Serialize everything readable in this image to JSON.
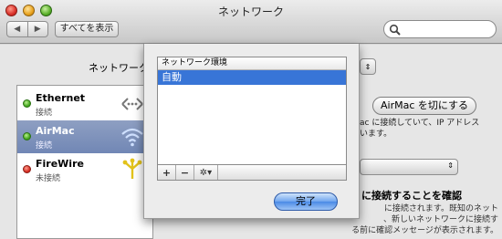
{
  "window": {
    "title": "ネットワーク",
    "back_glyph": "◀",
    "forward_glyph": "▶",
    "show_all_label": "すべてを表示",
    "search_icon": "search-icon"
  },
  "location": {
    "label": "ネットワーク",
    "popup_glyph": "⇕"
  },
  "services": [
    {
      "name": "Ethernet",
      "status": "接続",
      "status_color": "#3ea21a",
      "icon": "ethernet-icon",
      "selected": false
    },
    {
      "name": "AirMac",
      "status": "接続",
      "status_color": "#3ea21a",
      "icon": "wifi-icon",
      "selected": true
    },
    {
      "name": "FireWire",
      "status": "未接続",
      "status_color": "#d2281d",
      "icon": "firewire-icon",
      "selected": false
    }
  ],
  "details": {
    "airmac_button_label": "AirMac を切にする",
    "description_1": "ac に接続していて、IP アドレス\nいます。",
    "network_popup_glyph": "⇕",
    "ask_title": "に接続することを確認",
    "description_2": "に接続されます。既知のネット\n、新しいネットワークに接続す\nる前に確認メッセージが表示されます。"
  },
  "sheet": {
    "table_header": "ネットワーク環境",
    "rows": [
      "自動"
    ],
    "selected_row": 0,
    "add_label": "+",
    "remove_label": "−",
    "gear_label": "✲▾",
    "done_label": "完了"
  },
  "colors": {
    "selection_blue": "#3875d7",
    "sidebar_selection": "#7f93bd",
    "default_button": "#6ea4ee"
  }
}
